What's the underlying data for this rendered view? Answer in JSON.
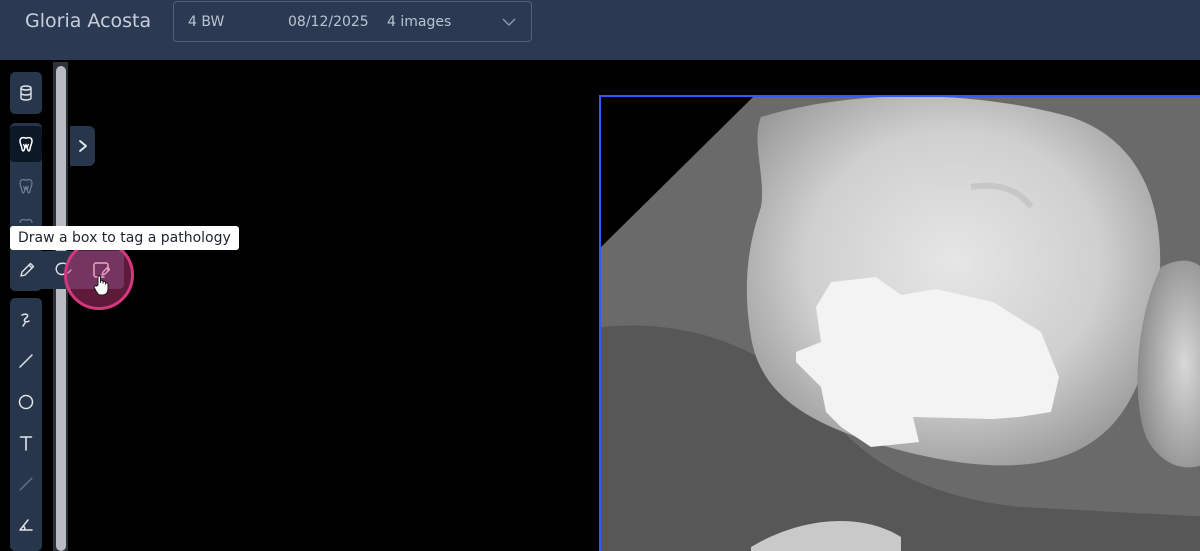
{
  "header": {
    "patient_name": "Gloria Acosta",
    "study": {
      "type": "4 BW",
      "date": "08/12/2025",
      "image_count": "4 images"
    }
  },
  "toolbar": {
    "tools": [
      {
        "icon": "database-icon",
        "active": false
      },
      {
        "icon": "tooth-icon",
        "active": true
      },
      {
        "icon": "tooth-outline-icon",
        "active": false
      },
      {
        "icon": "tooth-outline-icon",
        "active": false
      },
      {
        "icon": "pencil-icon",
        "active": false
      },
      {
        "icon": "freehand-icon",
        "active": false
      },
      {
        "icon": "line-icon",
        "active": false
      },
      {
        "icon": "circle-icon",
        "active": false
      },
      {
        "icon": "text-icon",
        "active": false
      },
      {
        "icon": "ruler-icon",
        "active": false
      },
      {
        "icon": "angle-icon",
        "active": false
      }
    ],
    "flyout": [
      {
        "icon": "pencil-icon"
      },
      {
        "icon": "lasso-tag-icon"
      },
      {
        "icon": "box-tag-icon",
        "hovered": true
      }
    ]
  },
  "tooltip": {
    "text": "Draw a box to tag a pathology"
  },
  "colors": {
    "header_bg": "#2b3a52",
    "toolbar_bg": "#27364a",
    "viewport_border": "#2e5bff",
    "highlight": "#d3387f"
  }
}
